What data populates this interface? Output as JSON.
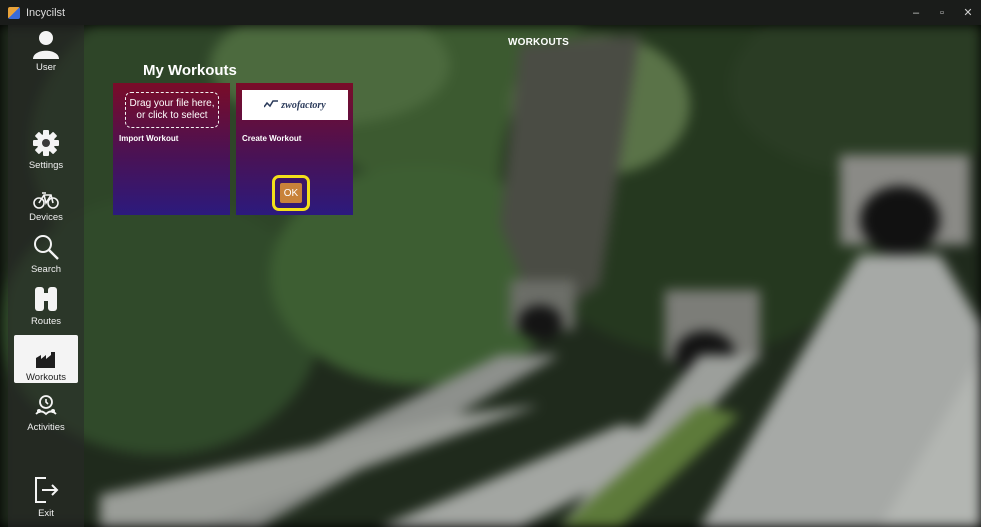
{
  "window": {
    "title": "Incycilst",
    "controls": [
      "–",
      "▫",
      "✕"
    ]
  },
  "sidebar": {
    "items": [
      {
        "label": "User",
        "icon": "user-icon",
        "active": false
      },
      {
        "label": "Settings",
        "icon": "gear-icon",
        "active": false
      },
      {
        "label": "Devices",
        "icon": "bicycle-icon",
        "active": false
      },
      {
        "label": "Search",
        "icon": "search-icon",
        "active": false
      },
      {
        "label": "Routes",
        "icon": "binoculars-icon",
        "active": false
      },
      {
        "label": "Workouts",
        "icon": "factory-icon",
        "active": true
      },
      {
        "label": "Activities",
        "icon": "activities-icon",
        "active": false
      },
      {
        "label": "Exit",
        "icon": "exit-icon",
        "active": false
      }
    ]
  },
  "page": {
    "title": "WORKOUTS",
    "section_title": "My Workouts"
  },
  "cards": {
    "import": {
      "drop_text": "Drag your file here, or click to select",
      "label": "Import Workout"
    },
    "create": {
      "logo_text": "zwofactory",
      "label": "Create Workout",
      "ok_label": "OK"
    }
  },
  "colors": {
    "card_top": "#7a0c28",
    "card_bottom": "#2c1a7d",
    "highlight": "#f2df1a",
    "ok_button": "#c8823a",
    "active_nav": "#f4f4f4"
  }
}
